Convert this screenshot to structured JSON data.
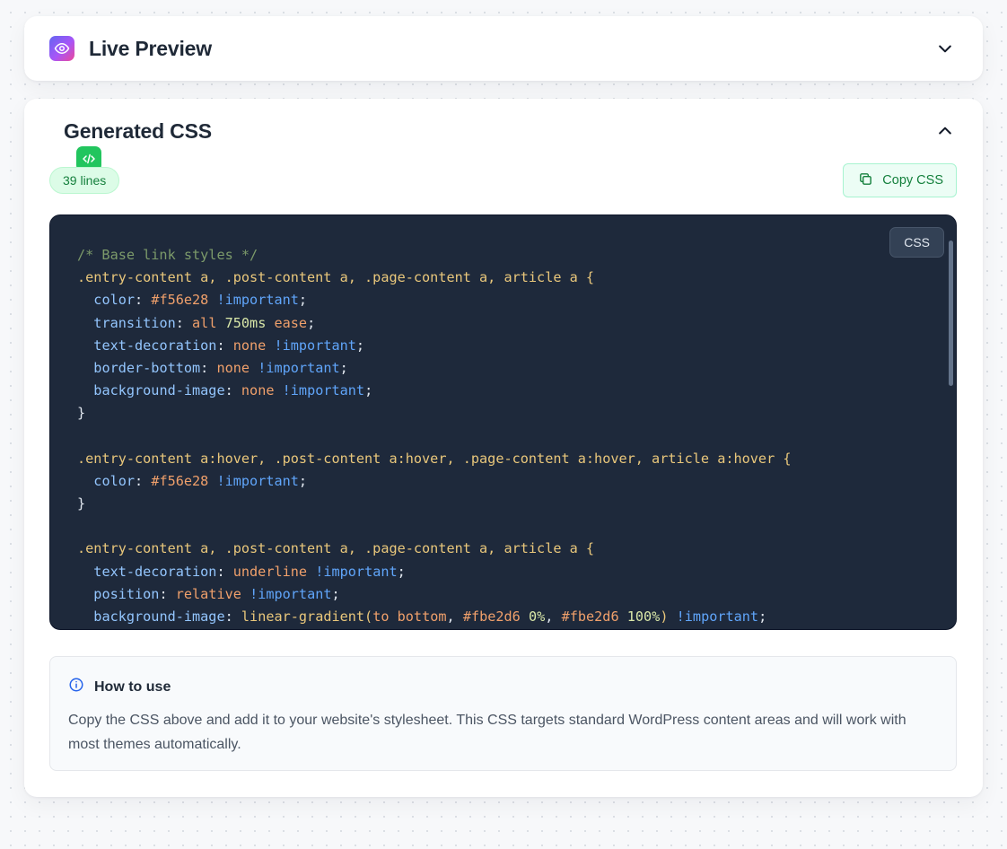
{
  "preview_panel": {
    "title": "Live Preview",
    "icon": "eye-icon",
    "state": "collapsed"
  },
  "css_panel": {
    "title": "Generated CSS",
    "icon": "code-icon",
    "state": "expanded",
    "line_count_badge": "39 lines",
    "copy_button_label": "Copy CSS",
    "language_tag": "CSS",
    "code_lines": [
      [
        [
          "com",
          "/* Base link styles */"
        ]
      ],
      [
        [
          "sel",
          ".entry-content a, .post-content a, .page-content a, article a {"
        ]
      ],
      [
        [
          "sp",
          "  "
        ],
        [
          "prop",
          "color"
        ],
        [
          "punc",
          ": "
        ],
        [
          "val",
          "#f56e28"
        ],
        [
          "punc",
          " "
        ],
        [
          "imp",
          "!important"
        ],
        [
          "punc",
          ";"
        ]
      ],
      [
        [
          "sp",
          "  "
        ],
        [
          "prop",
          "transition"
        ],
        [
          "punc",
          ": "
        ],
        [
          "val",
          "all"
        ],
        [
          "punc",
          " "
        ],
        [
          "num",
          "750ms"
        ],
        [
          "punc",
          " "
        ],
        [
          "val",
          "ease"
        ],
        [
          "punc",
          ";"
        ]
      ],
      [
        [
          "sp",
          "  "
        ],
        [
          "prop",
          "text-decoration"
        ],
        [
          "punc",
          ": "
        ],
        [
          "val",
          "none"
        ],
        [
          "punc",
          " "
        ],
        [
          "imp",
          "!important"
        ],
        [
          "punc",
          ";"
        ]
      ],
      [
        [
          "sp",
          "  "
        ],
        [
          "prop",
          "border-bottom"
        ],
        [
          "punc",
          ": "
        ],
        [
          "val",
          "none"
        ],
        [
          "punc",
          " "
        ],
        [
          "imp",
          "!important"
        ],
        [
          "punc",
          ";"
        ]
      ],
      [
        [
          "sp",
          "  "
        ],
        [
          "prop",
          "background-image"
        ],
        [
          "punc",
          ": "
        ],
        [
          "val",
          "none"
        ],
        [
          "punc",
          " "
        ],
        [
          "imp",
          "!important"
        ],
        [
          "punc",
          ";"
        ]
      ],
      [
        [
          "punc",
          "}"
        ]
      ],
      [
        [
          "sp",
          ""
        ]
      ],
      [
        [
          "sel",
          ".entry-content a:hover, .post-content a:hover, .page-content a:hover, article a:hover {"
        ]
      ],
      [
        [
          "sp",
          "  "
        ],
        [
          "prop",
          "color"
        ],
        [
          "punc",
          ": "
        ],
        [
          "val",
          "#f56e28"
        ],
        [
          "punc",
          " "
        ],
        [
          "imp",
          "!important"
        ],
        [
          "punc",
          ";"
        ]
      ],
      [
        [
          "punc",
          "}"
        ]
      ],
      [
        [
          "sp",
          ""
        ]
      ],
      [
        [
          "sel",
          ".entry-content a, .post-content a, .page-content a, article a {"
        ]
      ],
      [
        [
          "sp",
          "  "
        ],
        [
          "prop",
          "text-decoration"
        ],
        [
          "punc",
          ": "
        ],
        [
          "val",
          "underline"
        ],
        [
          "punc",
          " "
        ],
        [
          "imp",
          "!important"
        ],
        [
          "punc",
          ";"
        ]
      ],
      [
        [
          "sp",
          "  "
        ],
        [
          "prop",
          "position"
        ],
        [
          "punc",
          ": "
        ],
        [
          "val",
          "relative"
        ],
        [
          "punc",
          " "
        ],
        [
          "imp",
          "!important"
        ],
        [
          "punc",
          ";"
        ]
      ],
      [
        [
          "sp",
          "  "
        ],
        [
          "prop",
          "background-image"
        ],
        [
          "punc",
          ": "
        ],
        [
          "fn",
          "linear-gradient("
        ],
        [
          "val",
          "to bottom"
        ],
        [
          "punc",
          ", "
        ],
        [
          "val",
          "#fbe2d6"
        ],
        [
          "punc",
          " "
        ],
        [
          "num",
          "0%"
        ],
        [
          "punc",
          ", "
        ],
        [
          "val",
          "#fbe2d6"
        ],
        [
          "punc",
          " "
        ],
        [
          "num",
          "100%"
        ],
        [
          "fn",
          ")"
        ],
        [
          "punc",
          " "
        ],
        [
          "imp",
          "!important"
        ],
        [
          "punc",
          ";"
        ]
      ]
    ]
  },
  "how_to_use": {
    "icon": "info-icon",
    "title": "How to use",
    "text": "Copy the CSS above and add it to your website's stylesheet. This CSS targets standard WordPress content areas and will work with most themes automatically."
  },
  "colors": {
    "accent_green": "#22c55e",
    "code_background": "#1e293b",
    "badge_background": "#dcfce7"
  }
}
